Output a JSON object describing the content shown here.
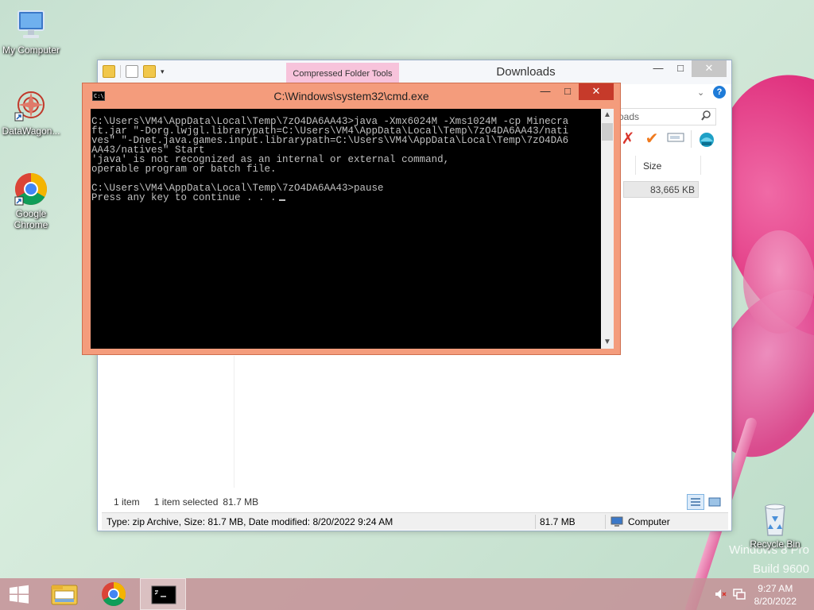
{
  "desktop": {
    "icons": [
      {
        "label": "My Computer"
      },
      {
        "label": "DataWagon..."
      },
      {
        "label": "Google Chrome"
      }
    ],
    "recycle_bin": "Recycle Bin",
    "watermark_line1": "Windows 8 Pro",
    "watermark_line2": "Build 9600"
  },
  "explorer": {
    "contextual_tab": "Compressed Folder Tools",
    "title": "Downloads",
    "controls": {
      "minimize": "—",
      "maximize": "□",
      "close": "✕"
    },
    "search_placeholder": "oads",
    "column_size": "Size",
    "file_size": "83,665 KB",
    "status": {
      "count": "1 item",
      "selected": "1 item selected",
      "selected_size": "81.7 MB"
    },
    "details": {
      "info": "Type: zip Archive, Size: 81.7 MB, Date modified: 8/20/2022 9:24 AM",
      "size": "81.7 MB",
      "location": "Computer"
    }
  },
  "cmd": {
    "title": "C:\\Windows\\system32\\cmd.exe",
    "icon_text": "C:\\",
    "controls": {
      "minimize": "—",
      "maximize": "□",
      "close": "✕"
    },
    "lines": [
      "C:\\Users\\VM4\\AppData\\Local\\Temp\\7zO4DA6AA43>java -Xmx6024M -Xms1024M -cp Minecra",
      "ft.jar \"-Dorg.lwjgl.librarypath=C:\\Users\\VM4\\AppData\\Local\\Temp\\7zO4DA6AA43/nati",
      "ves\" \"-Dnet.java.games.input.librarypath=C:\\Users\\VM4\\AppData\\Local\\Temp\\7zO4DA6",
      "AA43/natives\" Start",
      "'java' is not recognized as an internal or external command,",
      "operable program or batch file.",
      "",
      "C:\\Users\\VM4\\AppData\\Local\\Temp\\7zO4DA6AA43>pause",
      "Press any key to continue . . ."
    ]
  },
  "taskbar": {
    "time": "9:27 AM",
    "date": "8/20/2022"
  }
}
